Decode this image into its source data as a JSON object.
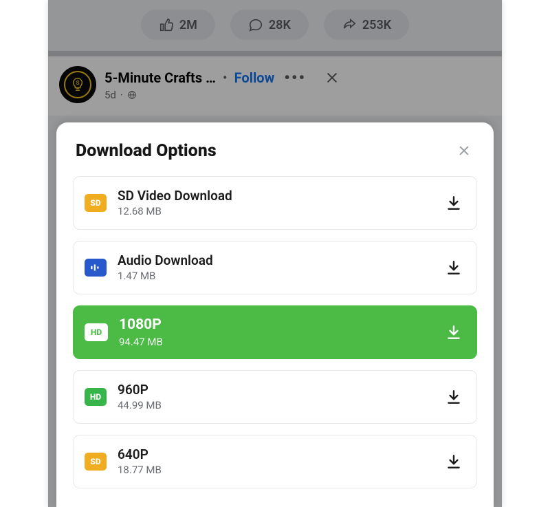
{
  "stats": {
    "likes": "2M",
    "comments": "28K",
    "shares": "253K"
  },
  "post": {
    "page_name": "5-Minute Crafts …",
    "separator": "•",
    "follow_label": "Follow",
    "more_label": "•••",
    "time": "5d",
    "time_sep": "·"
  },
  "sheet": {
    "title": "Download Options"
  },
  "options": [
    {
      "badge": "SD",
      "badge_kind": "sd",
      "title": "SD Video Download",
      "size": "12.68 MB",
      "selected": false
    },
    {
      "badge": "AUDIO",
      "badge_kind": "aud",
      "title": "Audio Download",
      "size": "1.47 MB",
      "selected": false
    },
    {
      "badge": "HD",
      "badge_kind": "hd",
      "title": "1080P",
      "size": "94.47 MB",
      "selected": true
    },
    {
      "badge": "HD",
      "badge_kind": "hd",
      "title": "960P",
      "size": "44.99 MB",
      "selected": false
    },
    {
      "badge": "SD",
      "badge_kind": "sd",
      "title": "640P",
      "size": "18.77 MB",
      "selected": false
    }
  ]
}
